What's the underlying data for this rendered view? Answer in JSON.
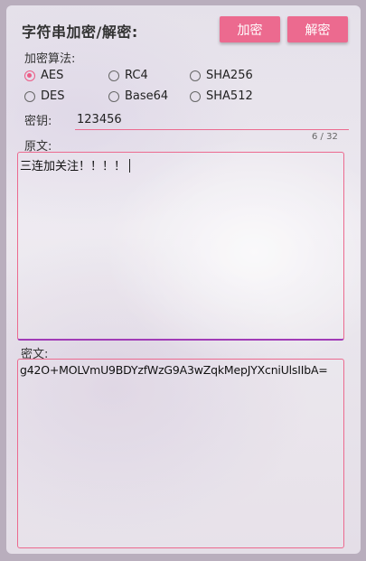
{
  "title": "字符串加密/解密:",
  "buttons": {
    "encrypt": "加密",
    "decrypt": "解密"
  },
  "algorithm_label": "加密算法:",
  "algorithms": [
    {
      "label": "AES",
      "checked": true
    },
    {
      "label": "RC4",
      "checked": false
    },
    {
      "label": "SHA256",
      "checked": false
    },
    {
      "label": "DES",
      "checked": false
    },
    {
      "label": "Base64",
      "checked": false
    },
    {
      "label": "SHA512",
      "checked": false
    }
  ],
  "key": {
    "label": "密钥:",
    "value": "123456",
    "counter": "6 / 32"
  },
  "plaintext": {
    "label": "原文:",
    "value": "三连加关注！！！！"
  },
  "ciphertext": {
    "label": "密文:",
    "value": "g42O+MOLVmU9BDYzfWzG9A3wZqkMepJYXcniUlsIIbA="
  },
  "colors": {
    "accent": "#ec6a8f",
    "radio_checked": "#ec5b86",
    "focus_underline": "#a13bb7"
  }
}
